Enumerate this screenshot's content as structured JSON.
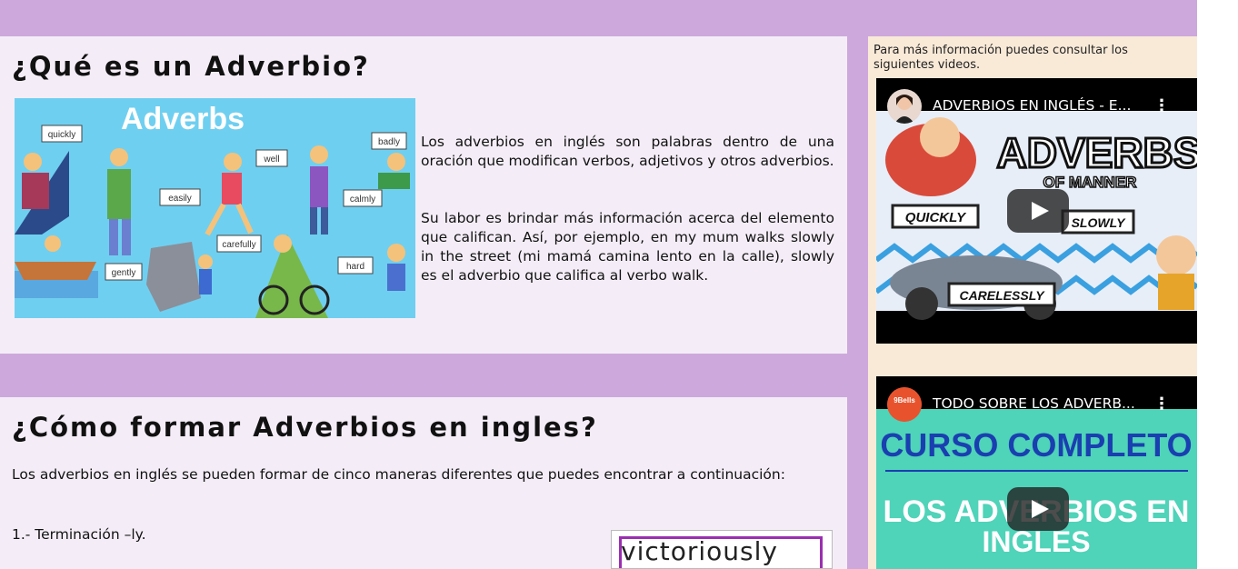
{
  "section1": {
    "title": "¿Qué es un Adverbio?",
    "image_alt_words": [
      "Adverbs",
      "quickly",
      "badly",
      "well",
      "easily",
      "calmly",
      "carefully",
      "gently",
      "hard"
    ],
    "para1": "Los adverbios en inglés son palabras dentro de una oración que modifican verbos, adjetivos y otros adverbios.",
    "para2": "Su labor es brindar más información acerca del elemento que califican. Así, por ejemplo, en my mum walks slowly in the street (mi mamá camina lento en la calle), slowly es el adverbio que califica al verbo walk."
  },
  "section2": {
    "title": "¿Cómo formar Adverbios en ingles?",
    "para1": "Los adverbios en inglés se pueden formar de cinco maneras diferentes que puedes encontrar a continuación:",
    "item1": "1.- Terminación –ly.",
    "image_word": "victoriously"
  },
  "aside": {
    "intro": "Para más información puedes consultar los siguientes videos.",
    "videos": [
      {
        "title": "ADVERBIOS EN INGLÉS - E...",
        "thumb_words": [
          "ADVERBS",
          "OF MANNER",
          "QUICKLY",
          "SLOWLY",
          "CARELESSLY"
        ]
      },
      {
        "title": "TODO SOBRE LOS ADVERB...",
        "channel_badge": "9Bells",
        "thumb_words": [
          "CURSO COMPLETO",
          "LOS ADVERBIOS EN",
          "INGLES"
        ]
      }
    ]
  },
  "colors": {
    "page_bg": "#cda8dc",
    "section_bg": "#f4edf7",
    "aside_bg": "#f9ead8",
    "hero_bg": "#6fcff0",
    "video2_bg": "#4fd3b9"
  }
}
